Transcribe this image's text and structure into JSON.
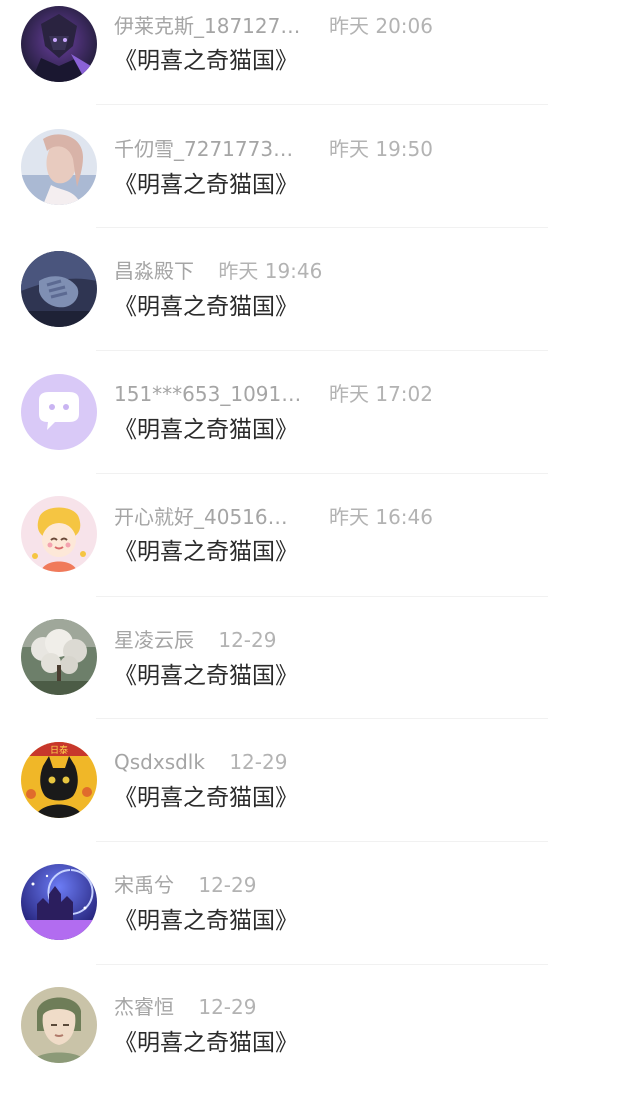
{
  "items": [
    {
      "username": "伊莱克斯_187127…",
      "time": "昨天 20:06",
      "title": "《明喜之奇猫国》",
      "avatar_icon": "dark-armor-character-avatar",
      "colors": [
        "#1d1b33",
        "#6b3fa0"
      ]
    },
    {
      "username": "千仞雪_7271773…",
      "time": "昨天 19:50",
      "title": "《明喜之奇猫国》",
      "avatar_icon": "girl-pale-portrait-avatar",
      "colors": [
        "#dfe5ef",
        "#c9a9a9"
      ]
    },
    {
      "username": "昌淼殿下",
      "time": "昨天 19:46",
      "title": "《明喜之奇猫国》",
      "avatar_icon": "dark-blue-hand-avatar",
      "colors": [
        "#2f3552",
        "#7f8fb3"
      ]
    },
    {
      "username": "151***653_1091…",
      "time": "昨天 17:02",
      "title": "《明喜之奇猫国》",
      "avatar_icon": "default-chat-bubble-avatar",
      "colors": [
        "#d9c9f7",
        "#ffffff"
      ]
    },
    {
      "username": "开心就好_40516…",
      "time": "昨天 16:46",
      "title": "《明喜之奇猫国》",
      "avatar_icon": "anime-chick-girl-avatar",
      "colors": [
        "#f7e3ea",
        "#f5c542"
      ]
    },
    {
      "username": "星凌云辰",
      "time": "12-29",
      "title": "《明喜之奇猫国》",
      "avatar_icon": "blossom-tree-avatar",
      "colors": [
        "#6d7f6a",
        "#e8e6e1"
      ]
    },
    {
      "username": "Qsdxsdlk",
      "time": "12-29",
      "title": "《明喜之奇猫国》",
      "avatar_icon": "black-cat-avatar",
      "colors": [
        "#f0b728",
        "#1a1a1a"
      ]
    },
    {
      "username": "宋禹兮",
      "time": "12-29",
      "title": "《明喜之奇猫国》",
      "avatar_icon": "purple-night-castle-avatar",
      "colors": [
        "#2e2c9a",
        "#b26cf0"
      ]
    },
    {
      "username": "杰睿恒",
      "time": "12-29",
      "title": "《明喜之奇猫国》",
      "avatar_icon": "anime-character-avatar",
      "colors": [
        "#c9c3a8",
        "#6e7d58"
      ]
    }
  ]
}
